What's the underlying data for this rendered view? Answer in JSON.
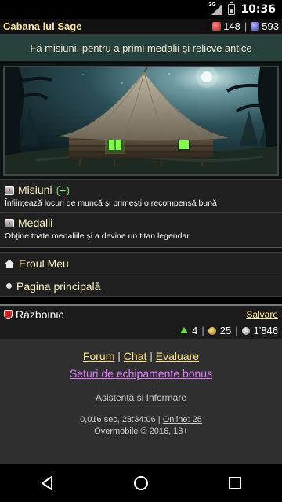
{
  "status_bar": {
    "time": "10:36",
    "network": "3G"
  },
  "header": {
    "title": "Cabana lui Sage",
    "red_gems": "148",
    "separator": "|",
    "blue_gems": "593"
  },
  "tagline": "Fă misiuni, pentru a primi medalii și relicve antice",
  "menu": {
    "missions": {
      "label": "Misiuni",
      "plus": "(+)",
      "desc": "Înfiinţează locuri de muncă şi primeşti o recompensă bună"
    },
    "medals": {
      "label": "Medalii",
      "desc": "Obţine toate medaliile şi a devine un titan legendar"
    },
    "my_hero": "Eroul Meu",
    "home": "Pagina principală"
  },
  "hero_panel": {
    "name": "Războinic",
    "save": "Salvare",
    "level": "4",
    "gold": "25",
    "silver": "1'846"
  },
  "footer": {
    "forum": "Forum",
    "chat": "Chat",
    "rating": "Evaluare",
    "bar": "|",
    "bonus": "Seturi de echipamente bonus",
    "support": "Asistență și Informare",
    "timing": "0,016 sec, 23:34:06 |",
    "online": "Online: 25",
    "copyright": "Overmobile © 2016, 18+"
  },
  "colors": {
    "accent_gold": "#ffe9a6",
    "tagline_bg": "#27413f",
    "plus_green": "#6adf6a",
    "bonus_purple": "#e17cff"
  }
}
